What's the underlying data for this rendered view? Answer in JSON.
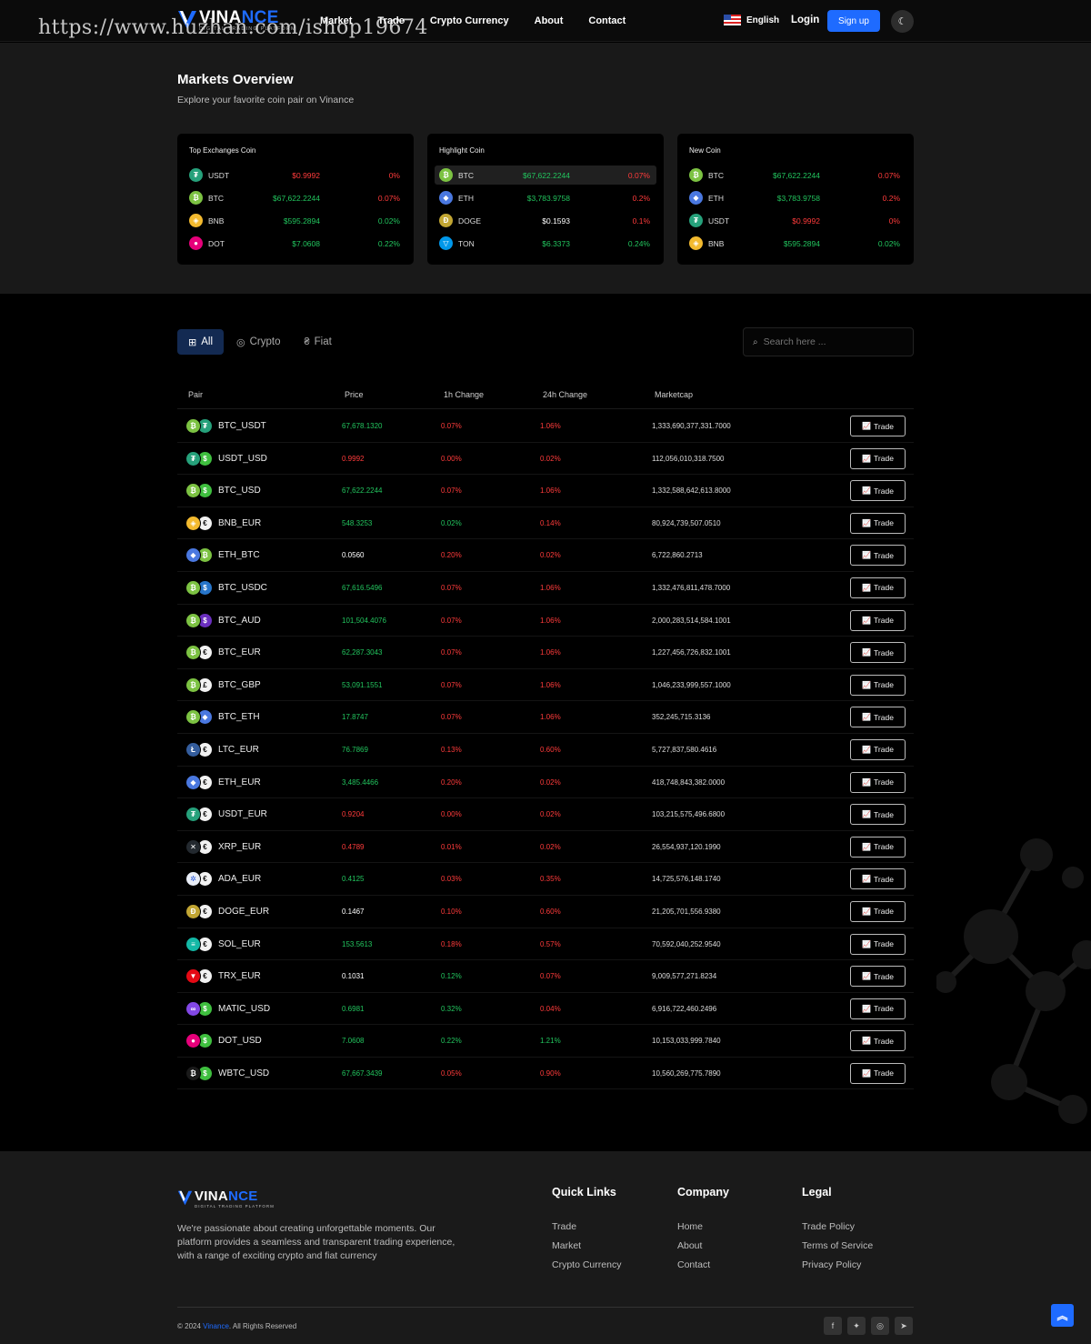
{
  "header": {
    "brand_main": "VINANCE",
    "brand_sub": "DIGITAL TRADING PLATFORM",
    "watermark": "https://www.huzhan.com/ishop19674",
    "nav": [
      "Market",
      "Trade",
      "Crypto Currency",
      "About",
      "Contact"
    ],
    "language": "English",
    "login": "Login",
    "signup": "Sign up"
  },
  "overview": {
    "title": "Markets Overview",
    "subtitle": "Explore your favorite coin pair on Vinance",
    "cards": [
      {
        "title": "Top Exchanges Coin",
        "rows": [
          {
            "symbol": "USDT",
            "price": "$0.9992",
            "change": "0%",
            "pc": "red",
            "cc": "red",
            "icon": "tether-icon",
            "color": "#26a17b",
            "glyph": "₮"
          },
          {
            "symbol": "BTC",
            "price": "$67,622.2244",
            "change": "0.07%",
            "pc": "green",
            "cc": "red",
            "icon": "bitcoin-icon",
            "color": "#7cc242",
            "glyph": "₿"
          },
          {
            "symbol": "BNB",
            "price": "$595.2894",
            "change": "0.02%",
            "pc": "green",
            "cc": "green",
            "icon": "bnb-icon",
            "color": "#f3ba2f",
            "glyph": "◈"
          },
          {
            "symbol": "DOT",
            "price": "$7.0608",
            "change": "0.22%",
            "pc": "green",
            "cc": "green",
            "icon": "polkadot-icon",
            "color": "#e6007a",
            "glyph": "●"
          }
        ]
      },
      {
        "title": "Highlight Coin",
        "rows": [
          {
            "symbol": "BTC",
            "price": "$67,622.2244",
            "change": "0.07%",
            "pc": "green",
            "cc": "red",
            "icon": "bitcoin-icon",
            "color": "#7cc242",
            "glyph": "₿"
          },
          {
            "symbol": "ETH",
            "price": "$3,783.9758",
            "change": "0.2%",
            "pc": "green",
            "cc": "red",
            "icon": "ethereum-icon",
            "color": "#4a78e0",
            "glyph": "◆"
          },
          {
            "symbol": "DOGE",
            "price": "$0.1593",
            "change": "0.1%",
            "pc": "white",
            "cc": "red",
            "icon": "dogecoin-icon",
            "color": "#c2a633",
            "glyph": "Ð"
          },
          {
            "symbol": "TON",
            "price": "$6.3373",
            "change": "0.24%",
            "pc": "green",
            "cc": "green",
            "icon": "toncoin-icon",
            "color": "#0098ea",
            "glyph": "▽"
          }
        ]
      },
      {
        "title": "New Coin",
        "rows": [
          {
            "symbol": "BTC",
            "price": "$67,622.2244",
            "change": "0.07%",
            "pc": "green",
            "cc": "red",
            "icon": "bitcoin-icon",
            "color": "#7cc242",
            "glyph": "₿"
          },
          {
            "symbol": "ETH",
            "price": "$3,783.9758",
            "change": "0.2%",
            "pc": "green",
            "cc": "red",
            "icon": "ethereum-icon",
            "color": "#4a78e0",
            "glyph": "◆"
          },
          {
            "symbol": "USDT",
            "price": "$0.9992",
            "change": "0%",
            "pc": "red",
            "cc": "red",
            "icon": "tether-icon",
            "color": "#26a17b",
            "glyph": "₮"
          },
          {
            "symbol": "BNB",
            "price": "$595.2894",
            "change": "0.02%",
            "pc": "green",
            "cc": "green",
            "icon": "bnb-icon",
            "color": "#f3ba2f",
            "glyph": "◈"
          }
        ]
      }
    ]
  },
  "market": {
    "tabs": [
      "All",
      "Crypto",
      "Fiat"
    ],
    "search_placeholder": "Search here ...",
    "columns": [
      "Pair",
      "Price",
      "1h Change",
      "24h Change",
      "Marketcap"
    ],
    "trade_label": "Trade",
    "rows": [
      {
        "pair": "BTC_USDT",
        "price": "67,678.1320",
        "h1": "0.07%",
        "h24": "1.06%",
        "mc": "1,333,690,377,331.7000",
        "pc": "green",
        "c1": "red",
        "c2": "red",
        "a": "#7cc242",
        "ag": "₿",
        "b": "#26a17b",
        "bg": "₮"
      },
      {
        "pair": "USDT_USD",
        "price": "0.9992",
        "h1": "0.00%",
        "h24": "0.02%",
        "mc": "112,056,010,318.7500",
        "pc": "red",
        "c1": "red",
        "c2": "red",
        "a": "#26a17b",
        "ag": "₮",
        "b": "#3fbf3f",
        "bg": "$"
      },
      {
        "pair": "BTC_USD",
        "price": "67,622.2244",
        "h1": "0.07%",
        "h24": "1.06%",
        "mc": "1,332,588,642,613.8000",
        "pc": "green",
        "c1": "red",
        "c2": "red",
        "a": "#7cc242",
        "ag": "₿",
        "b": "#3fbf3f",
        "bg": "$"
      },
      {
        "pair": "BNB_EUR",
        "price": "548.3253",
        "h1": "0.02%",
        "h24": "0.14%",
        "mc": "80,924,739,507.0510",
        "pc": "green",
        "c1": "green",
        "c2": "red",
        "a": "#f3ba2f",
        "ag": "◈",
        "b": "#f2f2f2",
        "bg": "€"
      },
      {
        "pair": "ETH_BTC",
        "price": "0.0560",
        "h1": "0.20%",
        "h24": "0.02%",
        "mc": "6,722,860.2713",
        "pc": "white",
        "c1": "red",
        "c2": "red",
        "a": "#4a78e0",
        "ag": "◆",
        "b": "#7cc242",
        "bg": "₿"
      },
      {
        "pair": "BTC_USDC",
        "price": "67,616.5496",
        "h1": "0.07%",
        "h24": "1.06%",
        "mc": "1,332,476,811,478.7000",
        "pc": "green",
        "c1": "red",
        "c2": "red",
        "a": "#7cc242",
        "ag": "₿",
        "b": "#2775ca",
        "bg": "$"
      },
      {
        "pair": "BTC_AUD",
        "price": "101,504.4076",
        "h1": "0.07%",
        "h24": "1.06%",
        "mc": "2,000,283,514,584.1001",
        "pc": "green",
        "c1": "red",
        "c2": "red",
        "a": "#7cc242",
        "ag": "₿",
        "b": "#6b2fbf",
        "bg": "$"
      },
      {
        "pair": "BTC_EUR",
        "price": "62,287.3043",
        "h1": "0.07%",
        "h24": "1.06%",
        "mc": "1,227,456,726,832.1001",
        "pc": "green",
        "c1": "red",
        "c2": "red",
        "a": "#7cc242",
        "ag": "₿",
        "b": "#f2f2f2",
        "bg": "€"
      },
      {
        "pair": "BTC_GBP",
        "price": "53,091.1551",
        "h1": "0.07%",
        "h24": "1.06%",
        "mc": "1,046,233,999,557.1000",
        "pc": "green",
        "c1": "red",
        "c2": "red",
        "a": "#7cc242",
        "ag": "₿",
        "b": "#f2f2f2",
        "bg": "£"
      },
      {
        "pair": "BTC_ETH",
        "price": "17.8747",
        "h1": "0.07%",
        "h24": "1.06%",
        "mc": "352,245,715.3136",
        "pc": "green",
        "c1": "red",
        "c2": "red",
        "a": "#7cc242",
        "ag": "₿",
        "b": "#4a78e0",
        "bg": "◆"
      },
      {
        "pair": "LTC_EUR",
        "price": "76.7869",
        "h1": "0.13%",
        "h24": "0.60%",
        "mc": "5,727,837,580.4616",
        "pc": "green",
        "c1": "red",
        "c2": "red",
        "a": "#345d9d",
        "ag": "Ł",
        "b": "#f2f2f2",
        "bg": "€"
      },
      {
        "pair": "ETH_EUR",
        "price": "3,485.4466",
        "h1": "0.20%",
        "h24": "0.02%",
        "mc": "418,748,843,382.0000",
        "pc": "green",
        "c1": "red",
        "c2": "red",
        "a": "#4a78e0",
        "ag": "◆",
        "b": "#f2f2f2",
        "bg": "€"
      },
      {
        "pair": "USDT_EUR",
        "price": "0.9204",
        "h1": "0.00%",
        "h24": "0.02%",
        "mc": "103,215,575,496.6800",
        "pc": "red",
        "c1": "red",
        "c2": "red",
        "a": "#26a17b",
        "ag": "₮",
        "b": "#f2f2f2",
        "bg": "€"
      },
      {
        "pair": "XRP_EUR",
        "price": "0.4789",
        "h1": "0.01%",
        "h24": "0.02%",
        "mc": "26,554,937,120.1990",
        "pc": "red",
        "c1": "red",
        "c2": "red",
        "a": "#23292f",
        "ag": "✕",
        "b": "#f2f2f2",
        "bg": "€"
      },
      {
        "pair": "ADA_EUR",
        "price": "0.4125",
        "h1": "0.03%",
        "h24": "0.35%",
        "mc": "14,725,576,148.1740",
        "pc": "green",
        "c1": "red",
        "c2": "red",
        "a": "#e9eef7",
        "ag": "✲",
        "b": "#f2f2f2",
        "bg": "€"
      },
      {
        "pair": "DOGE_EUR",
        "price": "0.1467",
        "h1": "0.10%",
        "h24": "0.60%",
        "mc": "21,205,701,556.9380",
        "pc": "white",
        "c1": "red",
        "c2": "red",
        "a": "#c2a633",
        "ag": "Ð",
        "b": "#f2f2f2",
        "bg": "€"
      },
      {
        "pair": "SOL_EUR",
        "price": "153.5613",
        "h1": "0.18%",
        "h24": "0.57%",
        "mc": "70,592,040,252.9540",
        "pc": "green",
        "c1": "red",
        "c2": "red",
        "a": "#14b8a6",
        "ag": "≡",
        "b": "#f2f2f2",
        "bg": "€"
      },
      {
        "pair": "TRX_EUR",
        "price": "0.1031",
        "h1": "0.12%",
        "h24": "0.07%",
        "mc": "9,009,577,271.8234",
        "pc": "white",
        "c1": "green",
        "c2": "red",
        "a": "#e50914",
        "ag": "▼",
        "b": "#f2f2f2",
        "bg": "€"
      },
      {
        "pair": "MATIC_USD",
        "price": "0.6981",
        "h1": "0.32%",
        "h24": "0.04%",
        "mc": "6,916,722,460.2496",
        "pc": "green",
        "c1": "green",
        "c2": "red",
        "a": "#8247e5",
        "ag": "∞",
        "b": "#3fbf3f",
        "bg": "$"
      },
      {
        "pair": "DOT_USD",
        "price": "7.0608",
        "h1": "0.22%",
        "h24": "1.21%",
        "mc": "10,153,033,999.7840",
        "pc": "green",
        "c1": "green",
        "c2": "green",
        "a": "#e6007a",
        "ag": "●",
        "b": "#3fbf3f",
        "bg": "$"
      },
      {
        "pair": "WBTC_USD",
        "price": "67,667.3439",
        "h1": "0.05%",
        "h24": "0.90%",
        "mc": "10,560,269,775.7890",
        "pc": "green",
        "c1": "red",
        "c2": "red",
        "a": "#1a1a1a",
        "ag": "₿",
        "b": "#3fbf3f",
        "bg": "$"
      }
    ]
  },
  "footer": {
    "description": "We're passionate about creating unforgettable moments. Our platform provides a seamless and transparent trading experience, with a range of exciting crypto and fiat currency",
    "columns": [
      {
        "title": "Quick Links",
        "links": [
          "Trade",
          "Market",
          "Crypto Currency"
        ]
      },
      {
        "title": "Company",
        "links": [
          "Home",
          "About",
          "Contact"
        ]
      },
      {
        "title": "Legal",
        "links": [
          "Trade Policy",
          "Terms of Service",
          "Privacy Policy"
        ]
      }
    ],
    "copyright_prefix": "© 2024 ",
    "copyright_brand": "Vinance",
    "copyright_suffix": ". All Rights Reserved",
    "socials": [
      "facebook-icon",
      "twitter-icon",
      "instagram-icon",
      "telegram-icon"
    ]
  },
  "colors": {
    "accent": "#1e6bff",
    "up": "#22c55e",
    "down": "#ff3b3b"
  }
}
